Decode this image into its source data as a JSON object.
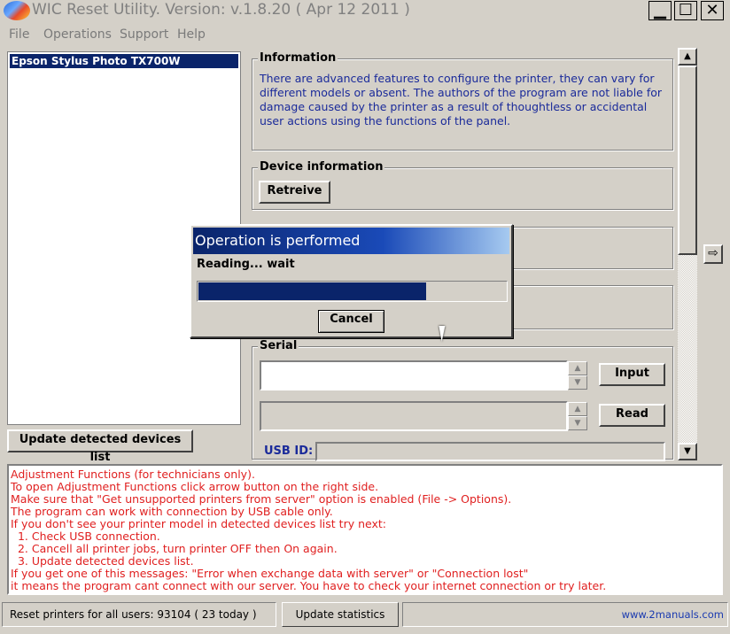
{
  "window": {
    "title": "WIC Reset Utility. Version: v.1.8.20 ( Apr 12 2011 )",
    "minimize_glyph": "▁",
    "maximize_glyph": "☐",
    "close_glyph": "✕"
  },
  "menu": [
    "File",
    "Operations",
    "Support",
    "Help"
  ],
  "devices": [
    "Epson Stylus Photo TX700W"
  ],
  "update_devices_label": "Update detected devices list",
  "information": {
    "title": "Information",
    "text": "There are advanced features to configure the printer, they can vary for different models or absent. The authors of the program are not liable for damage caused by the printer as a result of thoughtless or accidental user actions using the functions of the panel."
  },
  "device_info": {
    "title": "Device information",
    "retreive_label": "Retreive"
  },
  "serial": {
    "title": "Serial",
    "value": "",
    "input_label": "Input",
    "read_label": "Read",
    "usb_label": "USB ID:",
    "usb_value": ""
  },
  "scroll": {
    "up_glyph": "▲",
    "down_glyph": "▼",
    "side_arrow_glyph": "⇨"
  },
  "log_lines": [
    "Adjustment Functions (for technicians only).",
    "To open Adjustment Functions click arrow button on the right side.",
    "Make sure that \"Get unsupported printers from server\" option is enabled (File -> Options).",
    "The program can work with connection by USB cable only.",
    "If you don't see your printer model in detected devices list try next:",
    "  1. Check USB connection.",
    "  2. Cancell all printer jobs, turn printer OFF then On again.",
    "  3. Update detected devices list.",
    "If you get one of this messages: \"Error when exchange data with server\" or \"Connection lost\"",
    "it means the program cant connect with our server. You have to check your internet connection or try later."
  ],
  "status": {
    "users": "Reset printers for all users: 93104 ( 23 today )",
    "update_stats_label": "Update statistics",
    "link": "www.2manuals.com"
  },
  "dialog": {
    "title": "Operation is performed",
    "message": "Reading... wait",
    "progress": 0.74,
    "cancel_label": "Cancel"
  },
  "colors": {
    "face": "#d4d0c8",
    "selection": "#0a246a",
    "info_text": "#1a2a9a",
    "log_text": "#e02020",
    "link": "#1a3ab0"
  }
}
